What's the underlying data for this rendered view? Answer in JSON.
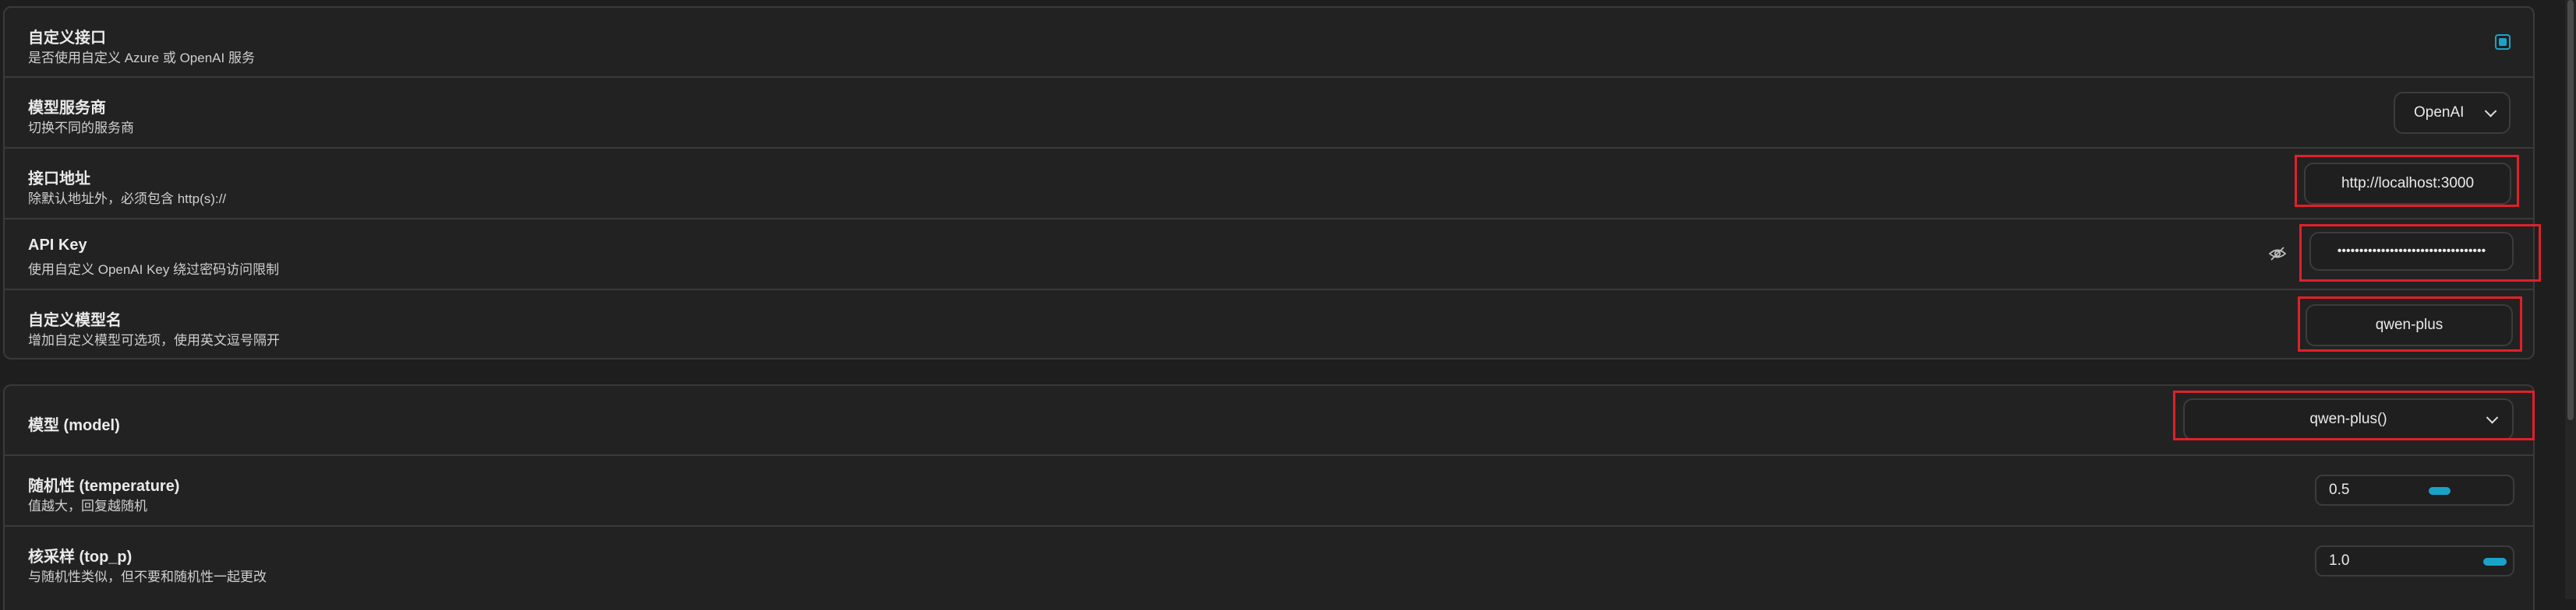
{
  "settings_card_1": {
    "rows": [
      {
        "title": "自定义接口",
        "subtitle": "是否使用自定义 Azure 或 OpenAI 服务"
      },
      {
        "title": "模型服务商",
        "subtitle": "切换不同的服务商",
        "value": "OpenAI"
      },
      {
        "title": "接口地址",
        "subtitle": "除默认地址外，必须包含 http(s)://",
        "value": "http://localhost:3000"
      },
      {
        "title": "API Key",
        "subtitle": "使用自定义 OpenAI Key 绕过密码访问限制",
        "value": "••••••••••••••••••••••••••••••••••"
      },
      {
        "title": "自定义模型名",
        "subtitle": "增加自定义模型可选项，使用英文逗号隔开",
        "value": "qwen-plus"
      }
    ]
  },
  "settings_card_2": {
    "rows": [
      {
        "title": "模型 (model)",
        "value": "qwen-plus()"
      },
      {
        "title": "随机性 (temperature)",
        "subtitle": "值越大，回复越随机",
        "value": "0.5",
        "slider_level": 0.5
      },
      {
        "title": "核采样 (top_p)",
        "subtitle": "与随机性类似，但不要和随机性一起更改",
        "value": "1.0",
        "slider_level": 1.0
      }
    ]
  },
  "colors": {
    "accent": "#1aa3c9",
    "highlight": "#e0202a",
    "background": "#1e1e1e",
    "card": "#222222",
    "border": "#3a3a3a"
  }
}
